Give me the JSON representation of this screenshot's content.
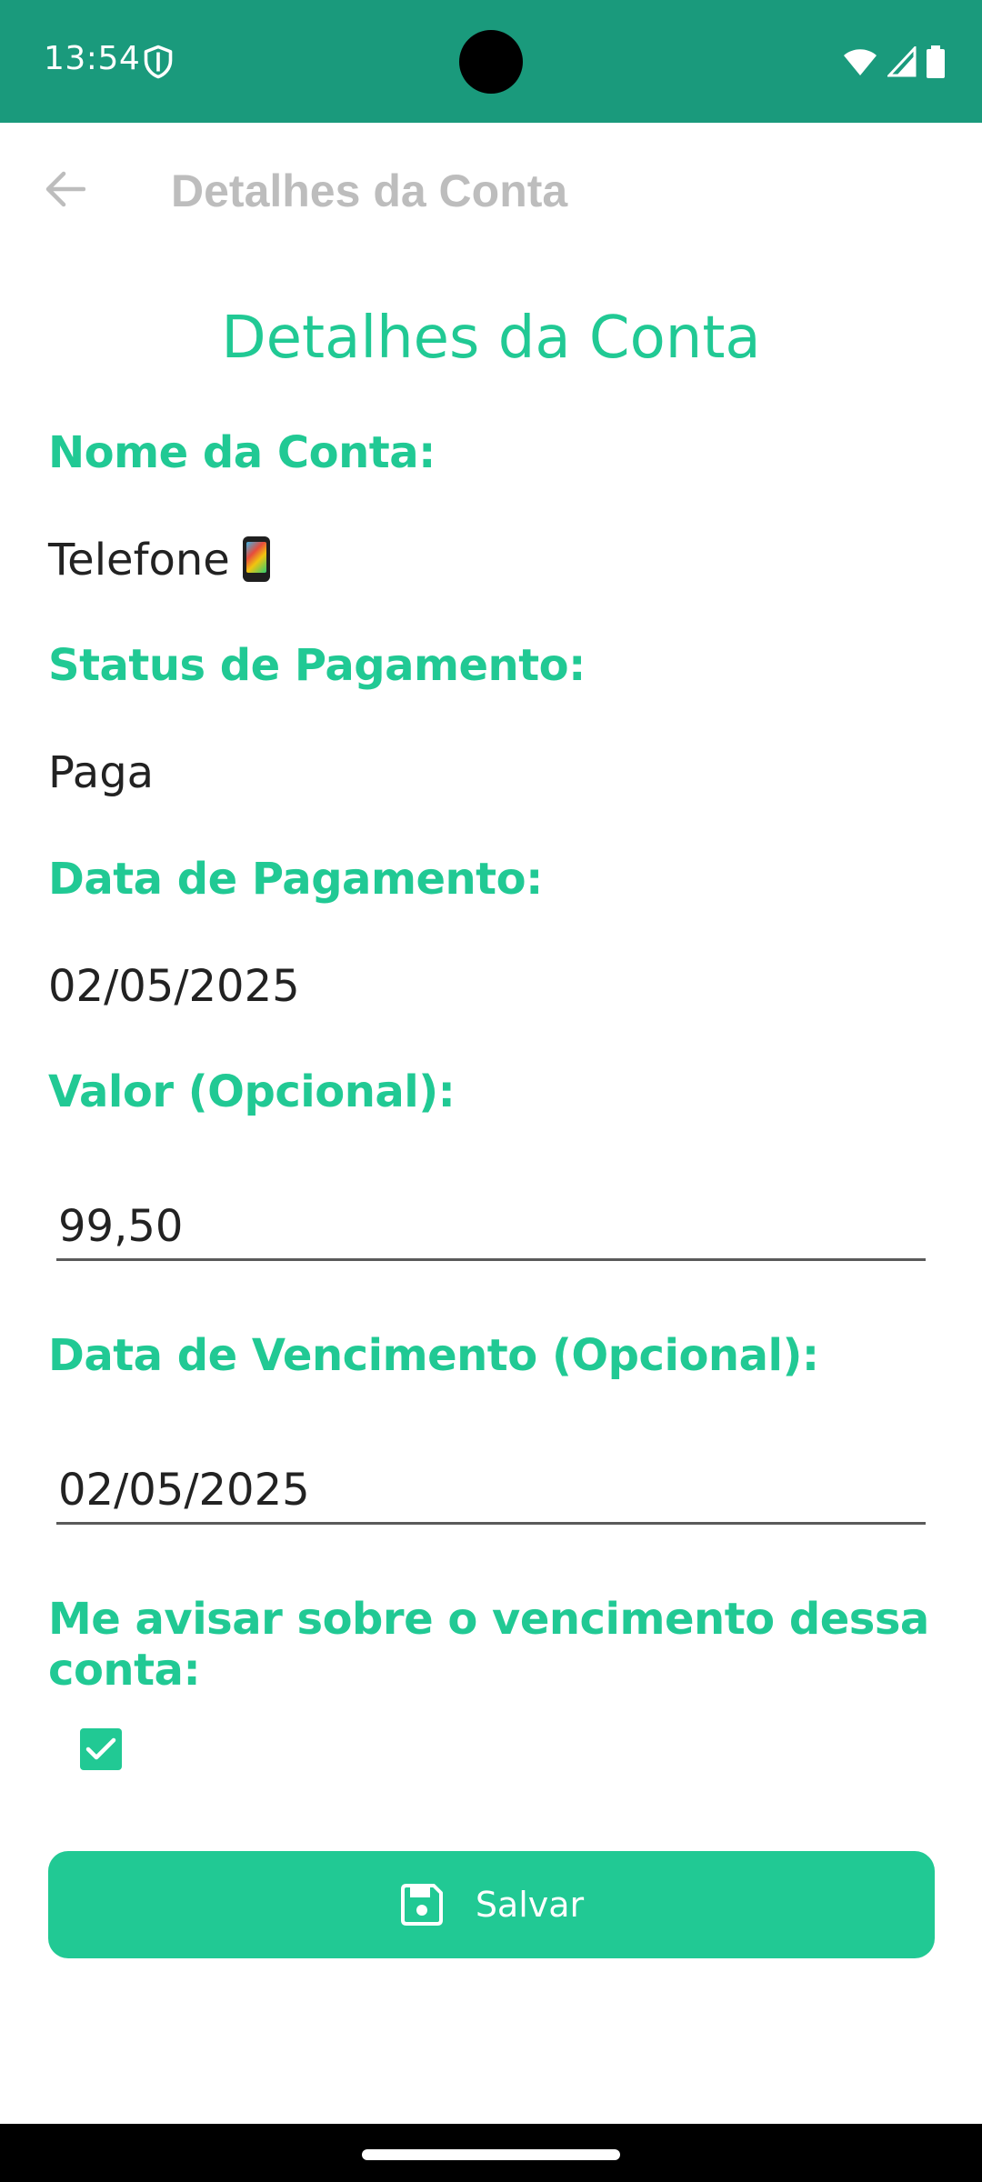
{
  "status_bar": {
    "time": "13:54",
    "background_color": "#1a9a7c",
    "icons": [
      "shield-icon",
      "wifi-icon",
      "signal-icon",
      "battery-icon"
    ]
  },
  "app_bar": {
    "title": "Detalhes da Conta",
    "back_icon": "arrow-left-icon"
  },
  "page": {
    "title": "Detalhes da Conta",
    "accent_color": "#21c994"
  },
  "fields": {
    "account_name_label": "Nome da Conta:",
    "account_name_value": "Telefone",
    "account_name_emoji": "mobile-phone-emoji",
    "payment_status_label": "Status de Pagamento:",
    "payment_status_value": "Paga",
    "payment_date_label": "Data de Pagamento:",
    "payment_date_value": "02/05/2025",
    "amount_label": "Valor (Opcional):",
    "amount_value": "99,50",
    "due_date_label": "Data de Vencimento (Opcional):",
    "due_date_value": "02/05/2025",
    "reminder_label": "Me avisar sobre o vencimento dessa conta:",
    "reminder_checked": true
  },
  "actions": {
    "save_label": "Salvar",
    "save_icon": "floppy-disk-icon"
  }
}
